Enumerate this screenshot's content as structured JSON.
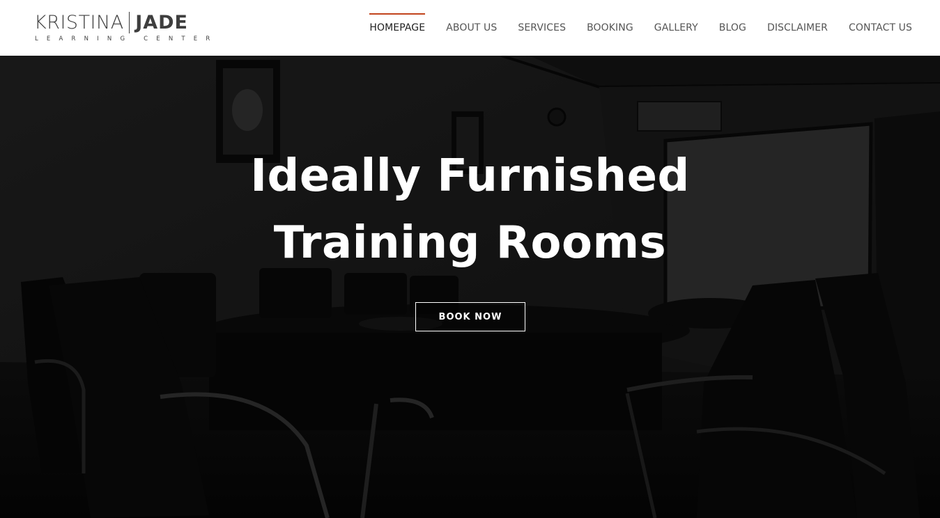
{
  "brand": {
    "name_first": "KRISTINA",
    "name_second": "JADE",
    "subtitle": "LEARNING CENTER"
  },
  "nav": {
    "items": [
      {
        "label": "HOMEPAGE",
        "active": true
      },
      {
        "label": "ABOUT US",
        "active": false
      },
      {
        "label": "SERVICES",
        "active": false
      },
      {
        "label": "BOOKING",
        "active": false
      },
      {
        "label": "GALLERY",
        "active": false
      },
      {
        "label": "BLOG",
        "active": false
      },
      {
        "label": "DISCLAIMER",
        "active": false
      },
      {
        "label": "CONTACT US",
        "active": false
      }
    ]
  },
  "hero": {
    "title_line1": "Ideally Furnished",
    "title_line2": "Training Rooms",
    "button_label": "BOOK NOW"
  },
  "colors": {
    "accent": "#c1441c",
    "logo_text": "#3e3e3e",
    "nav_text": "#555555",
    "hero_text": "#ffffff"
  }
}
